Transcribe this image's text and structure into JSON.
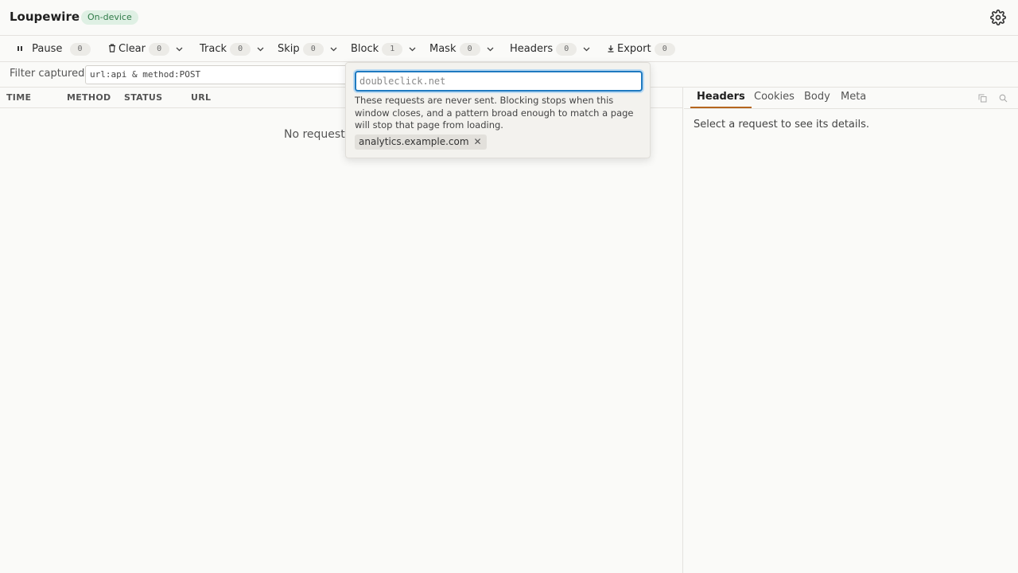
{
  "app": {
    "title": "Loupewire",
    "badge": "On-device"
  },
  "toolbar": {
    "pause": {
      "label": "Pause",
      "count": "0"
    },
    "clear": {
      "label": "Clear",
      "count": "0"
    },
    "track": {
      "label": "Track",
      "count": "0"
    },
    "skip": {
      "label": "Skip",
      "count": "0"
    },
    "block": {
      "label": "Block",
      "count": "1"
    },
    "mask": {
      "label": "Mask",
      "count": "0"
    },
    "headers": {
      "label": "Headers",
      "count": "0"
    },
    "export": {
      "label": "Export",
      "count": "0"
    }
  },
  "filter": {
    "label": "Filter captured",
    "value": "url:api & method:POST"
  },
  "list": {
    "columns": [
      "TIME",
      "METHOD",
      "STATUS",
      "URL"
    ],
    "empty": "No requests"
  },
  "detail": {
    "tabs": [
      "Headers",
      "Cookies",
      "Body",
      "Meta"
    ],
    "active_tab": "Headers",
    "empty": "Select a request to see its details."
  },
  "block_popover": {
    "placeholder": "doubleclick.net",
    "help": "These requests are never sent. Blocking stops when this window closes, and a pattern broad enough to match a page will stop that page from loading.",
    "patterns": [
      "analytics.example.com"
    ]
  },
  "colors": {
    "accent": "#b5651d",
    "focus": "#1f7ac0",
    "badge_bg": "#dff0e4",
    "badge_fg": "#2f7a48"
  }
}
